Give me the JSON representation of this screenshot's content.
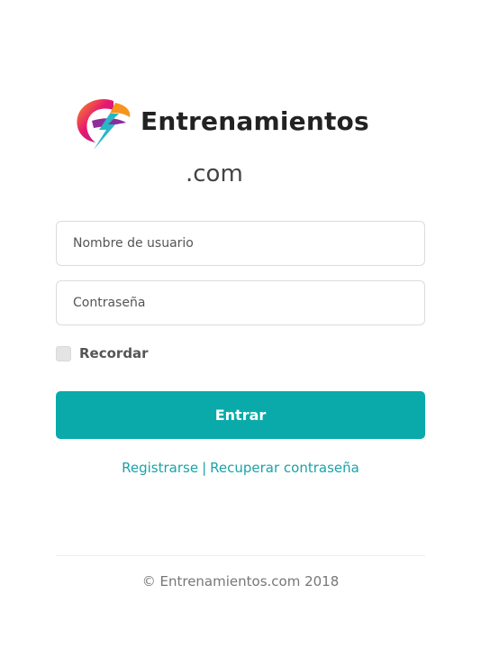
{
  "brand": {
    "name": "Entrenamientos",
    "tld": ".com",
    "logo_icon": "lightning-e-logo-icon"
  },
  "form": {
    "username_placeholder": "Nombre de usuario",
    "password_placeholder": "Contraseña",
    "remember_label": "Recordar",
    "remember_checked": false,
    "submit_label": "Entrar"
  },
  "links": {
    "register": "Registrarse",
    "separator": "|",
    "recover": "Recuperar contraseña"
  },
  "footer": {
    "copyright": "© Entrenamientos.com 2018"
  },
  "colors": {
    "accent": "#0aaaaa",
    "link": "#1aa3a8",
    "logo_pink": "#e8176f",
    "logo_orange": "#f7941d",
    "logo_purple": "#8e2c9a",
    "logo_teal": "#27b7c4"
  }
}
